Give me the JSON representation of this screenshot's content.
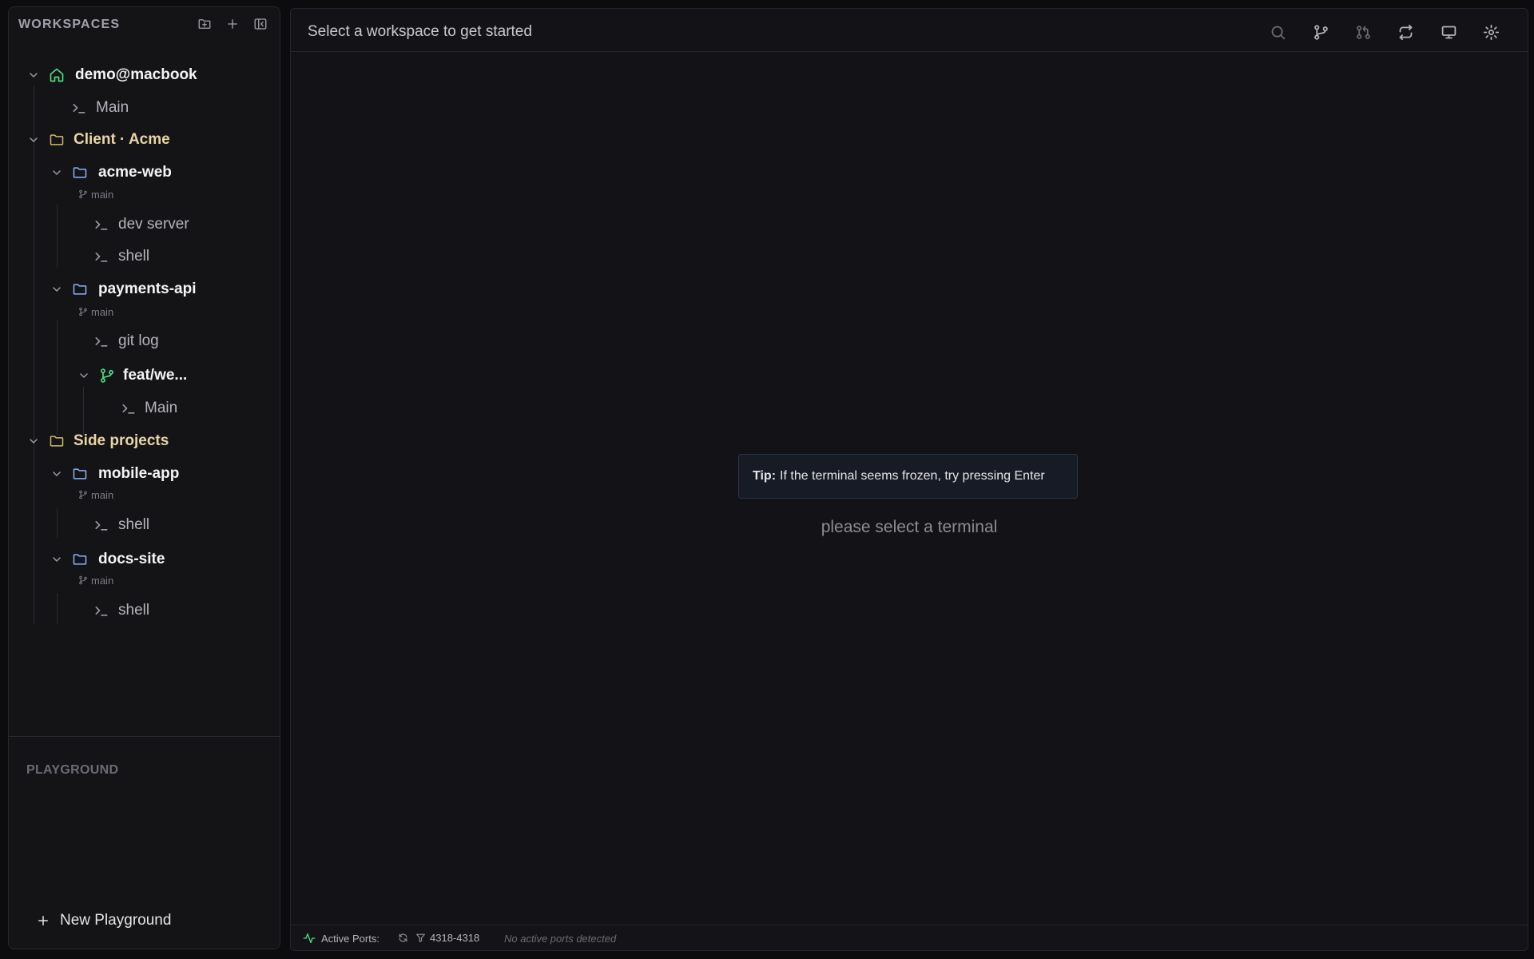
{
  "sidebar": {
    "title": "WORKSPACES",
    "tree": {
      "host": {
        "label": "demo@macbook",
        "terminals": [
          "Main"
        ]
      },
      "groups": [
        {
          "label": "Client · Acme",
          "repos": [
            {
              "label": "acme-web",
              "branch": "main",
              "terminals": [
                "dev server",
                "shell"
              ]
            },
            {
              "label": "payments-api",
              "branch": "main",
              "terminals": [
                "git log"
              ],
              "worktree": {
                "label": "feat/we...",
                "terminals": [
                  "Main"
                ]
              }
            }
          ]
        },
        {
          "label": "Side projects",
          "repos": [
            {
              "label": "mobile-app",
              "branch": "main",
              "terminals": [
                "shell"
              ]
            },
            {
              "label": "docs-site",
              "branch": "main",
              "terminals": [
                "shell"
              ]
            }
          ]
        }
      ]
    },
    "playground": {
      "title": "PLAYGROUND",
      "new_label": "New Playground"
    }
  },
  "main": {
    "title": "Select a workspace to get started",
    "tip": {
      "prefix": "Tip:",
      "text": "If the terminal seems frozen, try pressing Enter"
    },
    "empty_message": "please select a terminal"
  },
  "status": {
    "ports_label": "Active Ports:",
    "port_range": "4318-4318",
    "no_ports": "No active ports detected"
  },
  "colors": {
    "accent_green": "#4ade80",
    "folder_yellow": "#d4b86a",
    "folder_blue": "#8ab4f8"
  }
}
